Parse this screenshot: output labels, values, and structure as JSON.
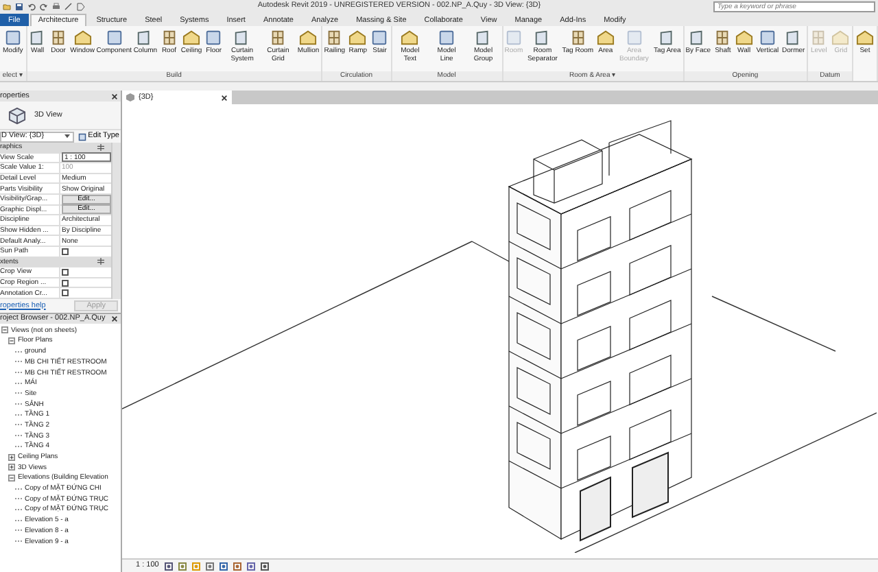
{
  "title_bar": {
    "title": "Autodesk Revit 2019 - UNREGISTERED VERSION - 002.NP_A.Quy - 3D View: {3D}",
    "search": {
      "placeholder": "Type a keyword or phrase"
    }
  },
  "ribbon_tabs": [
    {
      "label": "File",
      "kind": "file",
      "selected": false
    },
    {
      "label": "Architecture",
      "kind": "tab",
      "selected": true
    },
    {
      "label": "Structure",
      "kind": "tab",
      "selected": false
    },
    {
      "label": "Steel",
      "kind": "tab",
      "selected": false
    },
    {
      "label": "Systems",
      "kind": "tab",
      "selected": false
    },
    {
      "label": "Insert",
      "kind": "tab",
      "selected": false
    },
    {
      "label": "Annotate",
      "kind": "tab",
      "selected": false
    },
    {
      "label": "Analyze",
      "kind": "tab",
      "selected": false
    },
    {
      "label": "Massing & Site",
      "kind": "tab",
      "selected": false
    },
    {
      "label": "Collaborate",
      "kind": "tab",
      "selected": false
    },
    {
      "label": "View",
      "kind": "tab",
      "selected": false
    },
    {
      "label": "Manage",
      "kind": "tab",
      "selected": false
    },
    {
      "label": "Add-Ins",
      "kind": "tab",
      "selected": false
    },
    {
      "label": "Modify",
      "kind": "tab",
      "selected": false
    }
  ],
  "ribbon_panels": [
    {
      "label": "elect ▾",
      "tools": [
        {
          "label": "Modify",
          "disabled": false
        }
      ]
    },
    {
      "label": "Build",
      "tools": [
        {
          "label": "Wall",
          "disabled": false
        },
        {
          "label": "Door",
          "disabled": false
        },
        {
          "label": "Window",
          "disabled": false
        },
        {
          "label": "Component",
          "disabled": false
        },
        {
          "label": "Column",
          "disabled": false
        },
        {
          "label": "Roof",
          "disabled": false
        },
        {
          "label": "Ceiling",
          "disabled": false
        },
        {
          "label": "Floor",
          "disabled": false
        },
        {
          "label": "Curtain System",
          "disabled": false
        },
        {
          "label": "Curtain Grid",
          "disabled": false
        },
        {
          "label": "Mullion",
          "disabled": false
        }
      ]
    },
    {
      "label": "Circulation",
      "tools": [
        {
          "label": "Railing",
          "disabled": false
        },
        {
          "label": "Ramp",
          "disabled": false
        },
        {
          "label": "Stair",
          "disabled": false
        }
      ]
    },
    {
      "label": "Model",
      "tools": [
        {
          "label": "Model Text",
          "disabled": false
        },
        {
          "label": "Model Line",
          "disabled": false
        },
        {
          "label": "Model Group",
          "disabled": false
        }
      ]
    },
    {
      "label": "Room & Area ▾",
      "tools": [
        {
          "label": "Room",
          "disabled": true
        },
        {
          "label": "Room Separator",
          "disabled": false
        },
        {
          "label": "Tag Room",
          "disabled": false
        },
        {
          "label": "Area",
          "disabled": false
        },
        {
          "label": "Area Boundary",
          "disabled": true
        },
        {
          "label": "Tag Area",
          "disabled": false
        }
      ]
    },
    {
      "label": "Opening",
      "tools": [
        {
          "label": "By Face",
          "disabled": false
        },
        {
          "label": "Shaft",
          "disabled": false
        },
        {
          "label": "Wall",
          "disabled": false
        },
        {
          "label": "Vertical",
          "disabled": false
        },
        {
          "label": "Dormer",
          "disabled": false
        }
      ]
    },
    {
      "label": "Datum",
      "tools": [
        {
          "label": "Level",
          "disabled": true
        },
        {
          "label": "Grid",
          "disabled": true
        }
      ]
    },
    {
      "tools": [
        {
          "label": "Set",
          "disabled": false
        }
      ]
    }
  ],
  "properties": {
    "title": "roperties",
    "type_selector": {
      "label": "3D View"
    },
    "instance_selector": {
      "value": "D View: {3D}"
    },
    "edit_type_button": "Edit Type",
    "groups": [
      {
        "label": "raphics",
        "rows": [
          {
            "name": "View Scale",
            "kind": "field",
            "value": "1 : 100"
          },
          {
            "name": "Scale Value    1:",
            "kind": "readonly",
            "value": "100"
          },
          {
            "name": "Detail Level",
            "kind": "text",
            "value": "Medium"
          },
          {
            "name": "Parts Visibility",
            "kind": "text",
            "value": "Show Original"
          },
          {
            "name": "Visibility/Grap...",
            "kind": "button",
            "value": "Edit..."
          },
          {
            "name": "Graphic Displ...",
            "kind": "button",
            "value": "Edit..."
          },
          {
            "name": "Discipline",
            "kind": "text",
            "value": "Architectural"
          },
          {
            "name": "Show Hidden ...",
            "kind": "text",
            "value": "By Discipline"
          },
          {
            "name": "Default Analy...",
            "kind": "text",
            "value": "None"
          },
          {
            "name": "Sun Path",
            "kind": "checkbox",
            "checked": false
          }
        ]
      },
      {
        "label": "xtents",
        "rows": [
          {
            "name": "Crop View",
            "kind": "checkbox",
            "checked": false
          },
          {
            "name": "Crop Region ...",
            "kind": "checkbox",
            "checked": false
          },
          {
            "name": "Annotation Cr...",
            "kind": "checkbox",
            "checked": false
          }
        ]
      }
    ],
    "help_link": "roperties help",
    "apply_button": {
      "label": "Apply",
      "disabled": true
    }
  },
  "project_browser": {
    "title": "roject Browser - 002.NP_A.Quy",
    "tree": [
      {
        "label": "Views (not on sheets)",
        "expanded": true,
        "children": [
          {
            "label": "Floor Plans",
            "expanded": true,
            "children": [
              {
                "label": "ground"
              },
              {
                "label": "MB CHI TIẾT RESTROOM"
              },
              {
                "label": "MB CHI TIẾT RESTROOM"
              },
              {
                "label": "MÁI"
              },
              {
                "label": "Site"
              },
              {
                "label": "SẢNH"
              },
              {
                "label": "TẦNG 1"
              },
              {
                "label": "TẦNG 2"
              },
              {
                "label": "TẦNG 3"
              },
              {
                "label": "TẦNG 4"
              }
            ]
          },
          {
            "label": "Ceiling Plans",
            "expanded": false
          },
          {
            "label": "3D Views",
            "expanded": false
          },
          {
            "label": "Elevations (Building Elevation",
            "expanded": true,
            "children": [
              {
                "label": "Copy of MẶT ĐỨNG CHI"
              },
              {
                "label": "Copy of MẶT ĐỨNG TRỤC"
              },
              {
                "label": "Copy of MẶT ĐỨNG TRỤC"
              },
              {
                "label": "Elevation 5 - a"
              },
              {
                "label": "Elevation 8 - a"
              },
              {
                "label": "Elevation 9 - a"
              }
            ]
          }
        ]
      }
    ]
  },
  "view": {
    "tabs": [
      {
        "label": "{3D}",
        "selected": true
      }
    ],
    "scale": "1 : 100"
  }
}
